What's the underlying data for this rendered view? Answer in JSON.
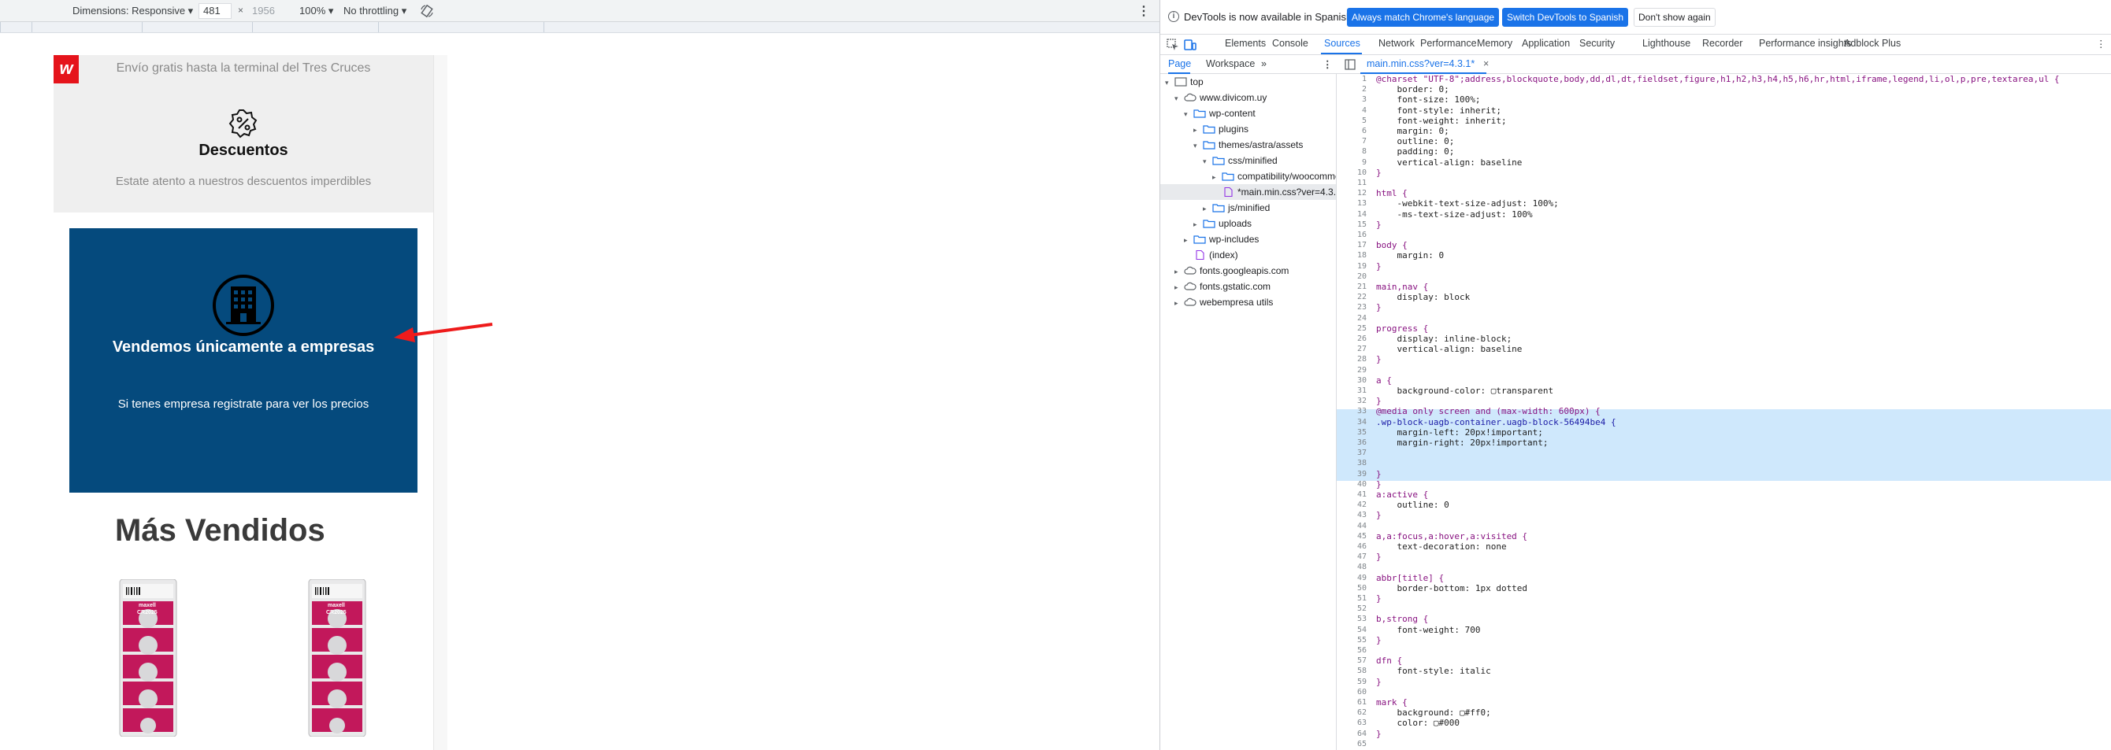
{
  "device_toolbar": {
    "dimensions_label": "Dimensions: Responsive ▾",
    "width": "481",
    "times": "×",
    "height": "1956",
    "zoom": "100% ▾",
    "throttling": "No throttling ▾"
  },
  "page": {
    "logo_letter": "w",
    "shipping_text": "Envío gratis hasta la terminal del Tres Cruces",
    "discount_title": "Descuentos",
    "discount_subtitle": "Estate atento a nuestros descuentos imperdibles",
    "companies_title": "Vendemos únicamente a empresas",
    "companies_subtitle": "Si tenes empresa registrate para ver los precios",
    "best_sellers": "Más Vendidos",
    "product_brand": "maxell",
    "product_model": "CR2025"
  },
  "devtools": {
    "infobar": {
      "message": "DevTools is now available in Spanish!",
      "btn_match": "Always match Chrome's language",
      "btn_switch": "Switch DevTools to Spanish",
      "btn_dont": "Don't show again"
    },
    "tabs": [
      "Elements",
      "Console",
      "Sources",
      "Network",
      "Performance",
      "Memory",
      "Application",
      "Security",
      "Lighthouse",
      "Recorder",
      "Performance insights",
      "Adblock Plus"
    ],
    "active_tab": "Sources",
    "subtabs": [
      "Page",
      "Workspace",
      "»"
    ],
    "tree": [
      {
        "label": "top",
        "icon": "frame-icon",
        "level": 0,
        "arrow": "▾"
      },
      {
        "label": "www.divicom.uy",
        "icon": "cloud-icon",
        "level": 1,
        "arrow": "▾"
      },
      {
        "label": "wp-content",
        "icon": "folder-icon",
        "level": 2,
        "arrow": "▾"
      },
      {
        "label": "plugins",
        "icon": "folder-icon",
        "level": 3,
        "arrow": "▸"
      },
      {
        "label": "themes/astra/assets",
        "icon": "folder-icon",
        "level": 3,
        "arrow": "▾"
      },
      {
        "label": "css/minified",
        "icon": "folder-icon",
        "level": 4,
        "arrow": "▾"
      },
      {
        "label": "compatibility/woocommerce",
        "icon": "folder-icon",
        "level": 5,
        "arrow": "▸"
      },
      {
        "label": "*main.min.css?ver=4.3.1",
        "icon": "file-icon",
        "level": 5,
        "arrow": ""
      },
      {
        "label": "js/minified",
        "icon": "folder-icon",
        "level": 4,
        "arrow": "▸"
      },
      {
        "label": "uploads",
        "icon": "folder-icon",
        "level": 3,
        "arrow": "▸"
      },
      {
        "label": "wp-includes",
        "icon": "folder-icon",
        "level": 2,
        "arrow": "▸"
      },
      {
        "label": "(index)",
        "icon": "file-icon",
        "level": 2,
        "arrow": ""
      },
      {
        "label": "fonts.googleapis.com",
        "icon": "cloud-icon",
        "level": 1,
        "arrow": "▸"
      },
      {
        "label": "fonts.gstatic.com",
        "icon": "cloud-icon",
        "level": 1,
        "arrow": "▸"
      },
      {
        "label": "webempresa utils",
        "icon": "cloud-icon",
        "level": 1,
        "arrow": "▸"
      }
    ],
    "open_file": "main.min.css?ver=4.3.1*",
    "code": [
      "@charset \"UTF-8\";address,blockquote,body,dd,dl,dt,fieldset,figure,h1,h2,h3,h4,h5,h6,hr,html,iframe,legend,li,ol,p,pre,textarea,ul {",
      "    border: 0;",
      "    font-size: 100%;",
      "    font-style: inherit;",
      "    font-weight: inherit;",
      "    margin: 0;",
      "    outline: 0;",
      "    padding: 0;",
      "    vertical-align: baseline",
      "}",
      "",
      "html {",
      "    -webkit-text-size-adjust: 100%;",
      "    -ms-text-size-adjust: 100%",
      "}",
      "",
      "body {",
      "    margin: 0",
      "}",
      "",
      "main,nav {",
      "    display: block",
      "}",
      "",
      "progress {",
      "    display: inline-block;",
      "    vertical-align: baseline",
      "}",
      "",
      "a {",
      "    background-color: ▢transparent",
      "}",
      "@media only screen and (max-width: 600px) {",
      ".wp-block-uagb-container.uagb-block-56494be4 {",
      "    margin-left: 20px!important;",
      "    margin-right: 20px!important;",
      "",
      "",
      "}",
      "}",
      "a:active {",
      "    outline: 0",
      "}",
      "",
      "a,a:focus,a:hover,a:visited {",
      "    text-decoration: none",
      "}",
      "",
      "abbr[title] {",
      "    border-bottom: 1px dotted",
      "}",
      "",
      "b,strong {",
      "    font-weight: 700",
      "}",
      "",
      "dfn {",
      "    font-style: italic",
      "}",
      "",
      "mark {",
      "    background: ▢#ff0;",
      "    color: ▢#000",
      "}",
      ""
    ],
    "colors": {
      "accent": "#1a73e8",
      "highlight": "#cfe8fc",
      "brand_red": "#e5141b",
      "blue_box": "#054a7d"
    }
  }
}
